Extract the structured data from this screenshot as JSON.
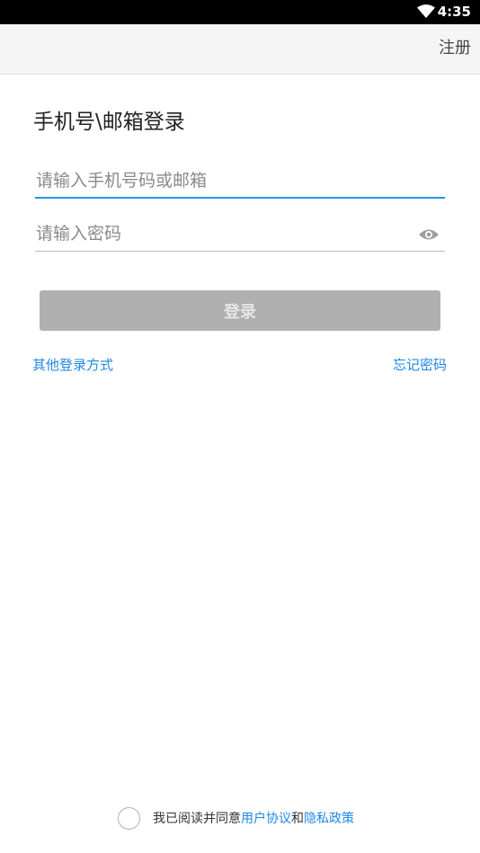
{
  "status_bar": {
    "time": "4:35",
    "wifi_icon": "wifi-icon"
  },
  "app_bar": {
    "register_label": "注册"
  },
  "login": {
    "title": "手机号\\邮箱登录",
    "account_placeholder": "请输入手机号码或邮箱",
    "account_value": "",
    "password_placeholder": "请输入密码",
    "password_value": "",
    "eye_icon": "eye-icon",
    "login_label": "登录",
    "other_login_label": "其他登录方式",
    "forgot_label": "忘记密码"
  },
  "agreement": {
    "prefix": "我已阅读并同意",
    "user_agreement": "用户协议",
    "conjunction": "和",
    "privacy_policy": "隐私政策",
    "checked": false
  },
  "colors": {
    "accent": "#1e88e5",
    "input_active_line": "#2196f3",
    "button_disabled": "#b0b0b0"
  }
}
